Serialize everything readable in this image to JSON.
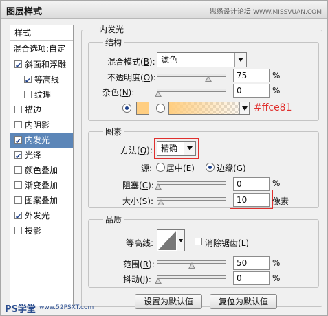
{
  "window": {
    "title": "图层样式",
    "watermark": "思缘设计论坛",
    "watermark_url": "WWW.MISSVUAN.COM"
  },
  "sidebar": {
    "header": "样式",
    "blend_options": "混合选项:自定",
    "items": [
      {
        "label": "斜面和浮雕",
        "checked": true
      },
      {
        "label": "等高线",
        "checked": true
      },
      {
        "label": "纹理",
        "checked": false
      },
      {
        "label": "描边",
        "checked": false
      },
      {
        "label": "内阴影",
        "checked": false
      },
      {
        "label": "内发光",
        "checked": true,
        "selected": true
      },
      {
        "label": "光泽",
        "checked": true
      },
      {
        "label": "颜色叠加",
        "checked": false
      },
      {
        "label": "渐变叠加",
        "checked": false
      },
      {
        "label": "图案叠加",
        "checked": false
      },
      {
        "label": "外发光",
        "checked": true
      },
      {
        "label": "投影",
        "checked": false
      }
    ]
  },
  "panel": {
    "title": "内发光",
    "structure": {
      "title": "结构",
      "blend_mode_label": "混合模式(B):",
      "blend_mode_label_parts": [
        "混合模式(",
        "B",
        "):"
      ],
      "blend_mode_value": "滤色",
      "opacity_label_parts": [
        "不透明度(",
        "O",
        "):"
      ],
      "opacity_value": "75",
      "opacity_level": 75,
      "noise_label_parts": [
        "杂色(",
        "N",
        "):"
      ],
      "noise_value": "0",
      "noise_level": 0,
      "percent": "%",
      "color_hex": "#ffce81",
      "color_annotation": "#ffce81"
    },
    "elements": {
      "title": "图素",
      "technique_label_parts": [
        "方法(",
        "Q",
        "):"
      ],
      "technique_value": "精确",
      "source_label": "源:",
      "source_center_parts": [
        "居中(",
        "E",
        ")"
      ],
      "source_edge_parts": [
        "边缘(",
        "G",
        ")"
      ],
      "choke_label_parts": [
        "阻塞(",
        "C",
        "):"
      ],
      "choke_value": "0",
      "choke_level": 0,
      "size_label_parts": [
        "大小(",
        "S",
        "):"
      ],
      "size_value": "10",
      "size_level": 4,
      "size_unit": "像素",
      "percent": "%"
    },
    "quality": {
      "title": "品质",
      "contour_label": "等高线:",
      "antialias_label_parts": [
        "消除锯齿(",
        "L",
        ")"
      ],
      "range_label_parts": [
        "范围(",
        "R",
        "):"
      ],
      "range_value": "50",
      "range_level": 50,
      "jitter_label_parts": [
        "抖动(",
        "J",
        "):"
      ],
      "jitter_value": "0",
      "jitter_level": 0,
      "percent": "%"
    },
    "buttons": {
      "make_default": "设置为默认值",
      "reset_default": "复位为默认值"
    }
  },
  "footer": {
    "logo": "PS学堂",
    "url": "www.52PSXT.com"
  },
  "colors": {
    "selected_row": "#5c86b8",
    "highlight": "#e0302e",
    "glow": "#ffce81"
  }
}
